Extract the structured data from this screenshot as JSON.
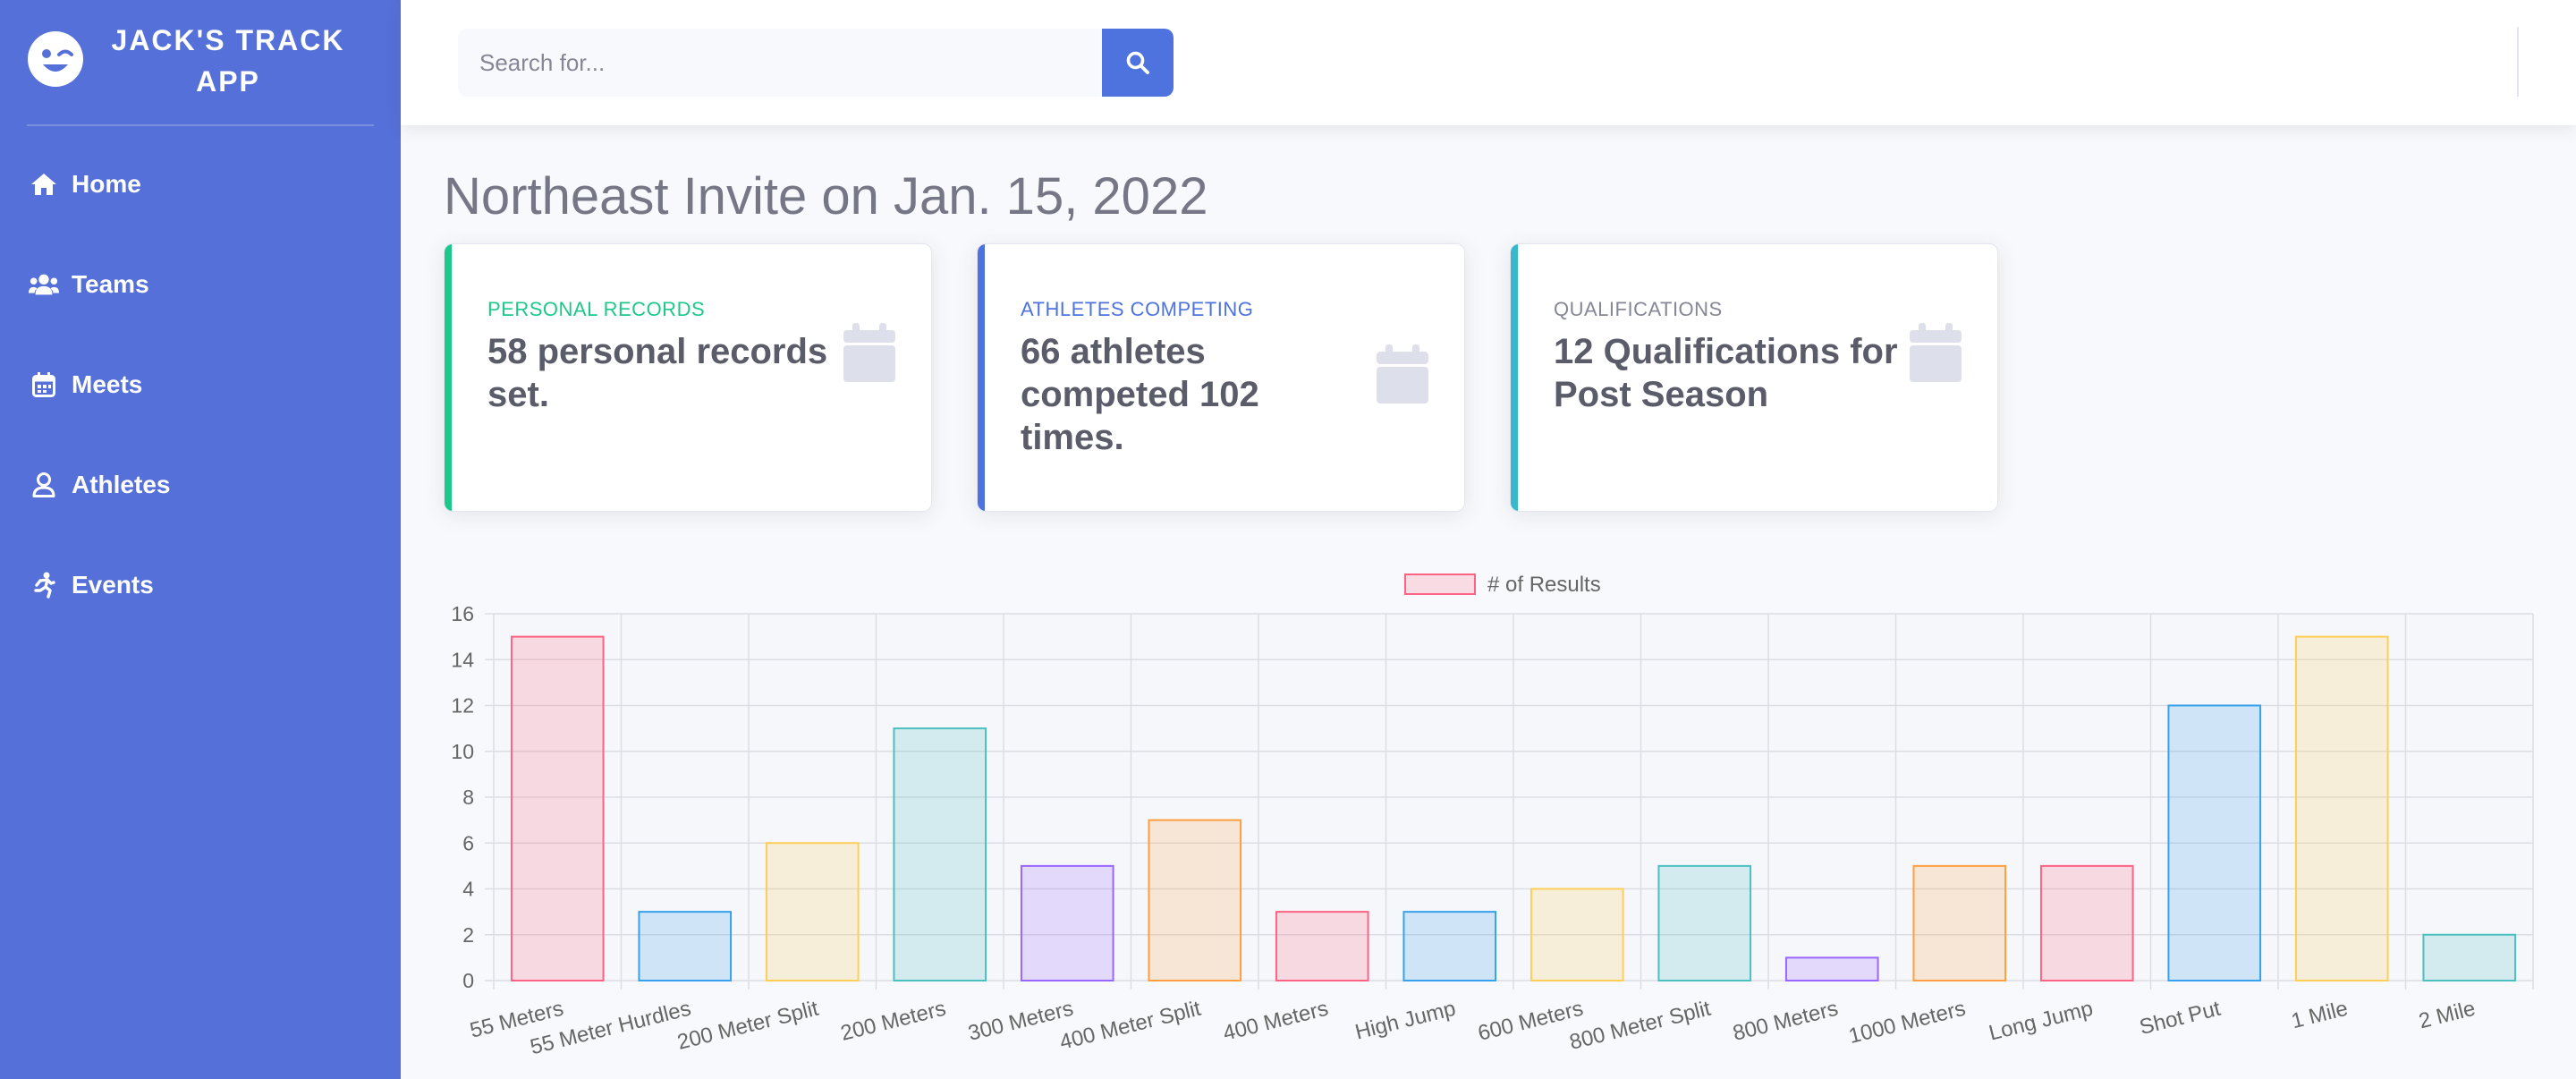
{
  "brand": {
    "line1": "JACK'S TRACK",
    "line2": "APP",
    "logo_icon": "winking-face-icon"
  },
  "nav": [
    {
      "label": "Home",
      "icon": "home-icon"
    },
    {
      "label": "Teams",
      "icon": "users-icon"
    },
    {
      "label": "Meets",
      "icon": "calendar-icon"
    },
    {
      "label": "Athletes",
      "icon": "user-icon"
    },
    {
      "label": "Events",
      "icon": "running-icon"
    }
  ],
  "search": {
    "placeholder": "Search for...",
    "value": ""
  },
  "page": {
    "title": "Northeast Invite on Jan. 15, 2022"
  },
  "cards": [
    {
      "label": "PERSONAL RECORDS",
      "value": "58 personal records set.",
      "accent": "#1cc88a",
      "icon": "calendar-icon"
    },
    {
      "label": "ATHLETES COMPETING",
      "value": "66 athletes competed 102 times.",
      "accent": "#4e73df",
      "icon": "calendar-icon"
    },
    {
      "label": "QUALIFICATIONS",
      "value": "12 Qualifications for Post Season",
      "accent": "#36b9cc",
      "icon": "calendar-icon"
    }
  ],
  "colors": {
    "sidebar": "#5670d9",
    "primary": "#4e73df"
  },
  "chart_data": {
    "type": "bar",
    "title": "",
    "xlabel": "",
    "ylabel": "",
    "legend": "top",
    "grid": true,
    "ylim": [
      0,
      16
    ],
    "yticks": [
      0,
      2,
      4,
      6,
      8,
      10,
      12,
      14,
      16
    ],
    "categories": [
      "55 Meters",
      "55 Meter Hurdles",
      "200 Meter Split",
      "200 Meters",
      "300 Meters",
      "400 Meter Split",
      "400 Meters",
      "High Jump",
      "600 Meters",
      "800 Meter Split",
      "800 Meters",
      "1000 Meters",
      "Long Jump",
      "Shot Put",
      "1 Mile",
      "2 Mile"
    ],
    "series": [
      {
        "name": "# of Results",
        "values": [
          15,
          3,
          6,
          11,
          5,
          7,
          3,
          3,
          4,
          5,
          1,
          5,
          5,
          12,
          15,
          2
        ]
      }
    ],
    "bar_colors": [
      {
        "fill": "rgba(255,99,132,0.2)",
        "stroke": "#ff6384"
      },
      {
        "fill": "rgba(54,162,235,0.2)",
        "stroke": "#36a2eb"
      },
      {
        "fill": "rgba(255,206,86,0.2)",
        "stroke": "#ffce56"
      },
      {
        "fill": "rgba(75,192,192,0.2)",
        "stroke": "#4bc0c0"
      },
      {
        "fill": "rgba(153,102,255,0.2)",
        "stroke": "#9966ff"
      },
      {
        "fill": "rgba(255,159,64,0.2)",
        "stroke": "#ff9f40"
      }
    ]
  }
}
